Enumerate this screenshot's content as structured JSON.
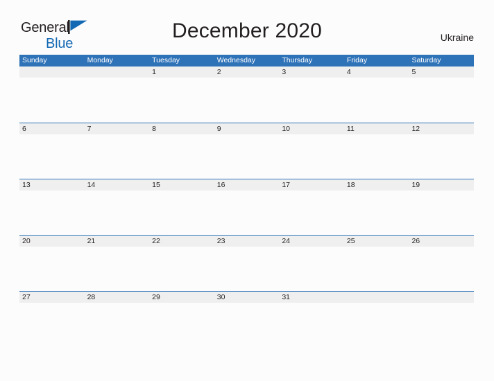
{
  "logo": {
    "word_one": "General",
    "word_two": "Blue",
    "flag_icon": "blue-triangle-flag-icon",
    "color_dark": "#231f20",
    "color_blue": "#1268b3"
  },
  "header": {
    "title": "December 2020",
    "country": "Ukraine"
  },
  "colors": {
    "header_blue": "#2e72b8",
    "row_band_gray": "#efefef",
    "page_background": "#fcfcfc",
    "text": "#231f20"
  },
  "calendar": {
    "month": "December",
    "year": "2020",
    "weekdays": [
      "Sunday",
      "Monday",
      "Tuesday",
      "Wednesday",
      "Thursday",
      "Friday",
      "Saturday"
    ],
    "weeks": [
      [
        "",
        "",
        "1",
        "2",
        "3",
        "4",
        "5"
      ],
      [
        "6",
        "7",
        "8",
        "9",
        "10",
        "11",
        "12"
      ],
      [
        "13",
        "14",
        "15",
        "16",
        "17",
        "18",
        "19"
      ],
      [
        "20",
        "21",
        "22",
        "23",
        "24",
        "25",
        "26"
      ],
      [
        "27",
        "28",
        "29",
        "30",
        "31",
        "",
        ""
      ]
    ]
  }
}
